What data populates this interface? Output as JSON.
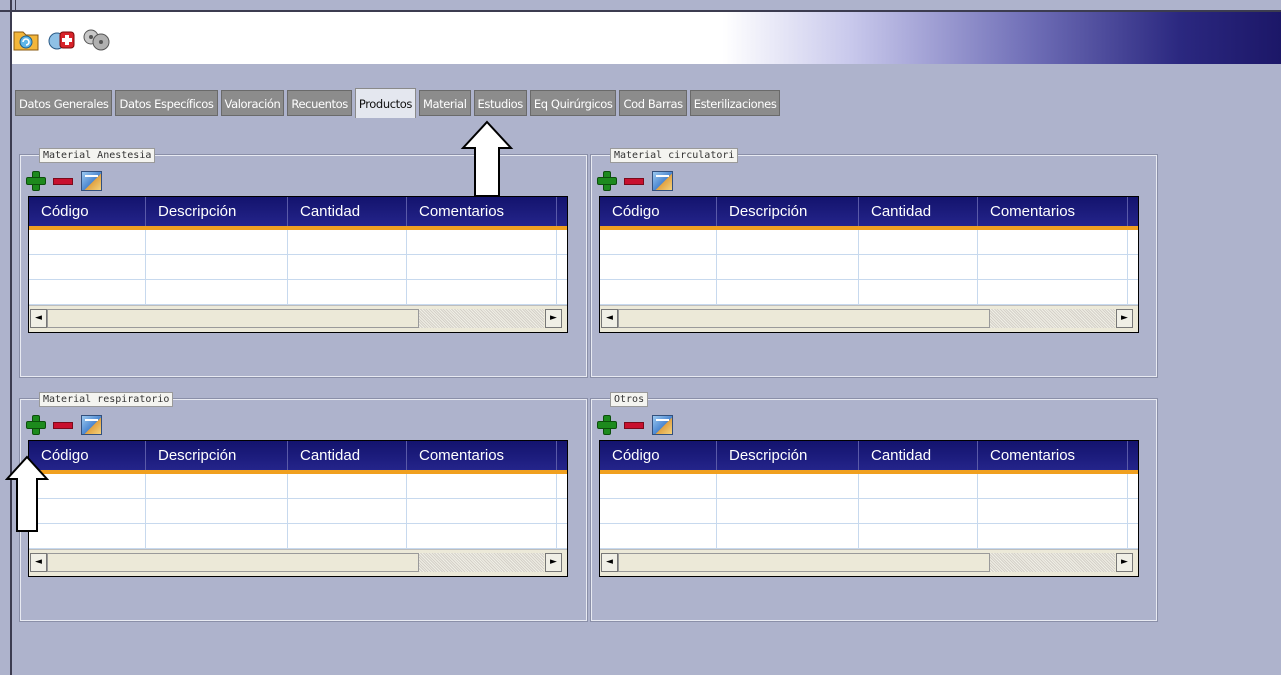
{
  "toolbar": {
    "icons": [
      "folder-refresh-icon",
      "medical-kit-icon",
      "film-reels-icon"
    ]
  },
  "tabs": [
    {
      "label": "Datos Generales",
      "active": false
    },
    {
      "label": "Datos Específicos",
      "active": false
    },
    {
      "label": "Valoración",
      "active": false
    },
    {
      "label": "Recuentos",
      "active": false
    },
    {
      "label": "Productos",
      "active": true
    },
    {
      "label": "Material",
      "active": false
    },
    {
      "label": "Estudios",
      "active": false
    },
    {
      "label": "Eq Quirúrgicos",
      "active": false
    },
    {
      "label": "Cod Barras",
      "active": false
    },
    {
      "label": "Esterilizaciones",
      "active": false
    }
  ],
  "groups": [
    {
      "title": "Material Anestesia"
    },
    {
      "title": "Material circulatori"
    },
    {
      "title": "Material respiratorio"
    },
    {
      "title": "Otros"
    }
  ],
  "grid": {
    "columns": [
      "Código",
      "Descripción",
      "Cantidad",
      "Comentarios"
    ]
  },
  "scroll": {
    "left": "◄",
    "right": "►"
  },
  "colors": {
    "header": "#1a1a7a",
    "header_underline": "#f0a020",
    "tab_inactive": "#8c8c8c",
    "background": "#aeb3cc"
  }
}
